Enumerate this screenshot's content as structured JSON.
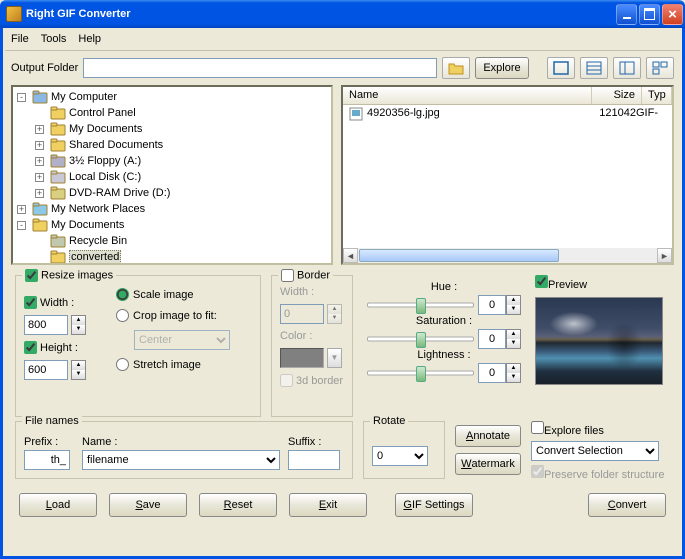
{
  "title": "Right GIF Converter",
  "menu": {
    "file": "File",
    "tools": "Tools",
    "help": "Help"
  },
  "topbar": {
    "output_label": "Output Folder",
    "output_value": "",
    "explore": "Explore"
  },
  "tree": [
    {
      "label": "My Computer",
      "icon": "computer",
      "exp": "-",
      "indent": 0
    },
    {
      "label": "Control Panel",
      "icon": "folder",
      "exp": "",
      "indent": 1
    },
    {
      "label": "My Documents",
      "icon": "folder",
      "exp": "+",
      "indent": 1
    },
    {
      "label": "Shared Documents",
      "icon": "folder",
      "exp": "+",
      "indent": 1
    },
    {
      "label": "3½ Floppy (A:)",
      "icon": "floppy",
      "exp": "+",
      "indent": 1
    },
    {
      "label": "Local Disk (C:)",
      "icon": "disk",
      "exp": "+",
      "indent": 1
    },
    {
      "label": "DVD-RAM Drive (D:)",
      "icon": "dvd",
      "exp": "+",
      "indent": 1
    },
    {
      "label": "My Network Places",
      "icon": "network",
      "exp": "+",
      "indent": 0
    },
    {
      "label": "My Documents",
      "icon": "folder",
      "exp": "-",
      "indent": 0
    },
    {
      "label": "Recycle Bin",
      "icon": "bin",
      "exp": "",
      "indent": 1
    },
    {
      "label": "converted",
      "icon": "folder",
      "exp": "",
      "indent": 1,
      "sel": true
    }
  ],
  "list": {
    "cols": {
      "name": "Name",
      "size": "Size",
      "type": "Typ"
    },
    "rows": [
      {
        "name": "4920356-lg.jpg",
        "size": "121042",
        "type": "GIF-"
      }
    ]
  },
  "resize": {
    "legend": "Resize images",
    "width_lbl": "Width :",
    "width": "800",
    "height_lbl": "Height :",
    "height": "600",
    "scale": "Scale image",
    "crop": "Crop image to fit:",
    "center": "Center",
    "stretch": "Stretch image"
  },
  "border": {
    "legend": "Border",
    "width_lbl": "Width :",
    "width": "0",
    "color_lbl": "Color :",
    "d3": "3d border"
  },
  "sliders": {
    "hue": "Hue :",
    "sat": "Saturation :",
    "light": "Lightness :",
    "val": "0"
  },
  "preview": {
    "legend": "Preview"
  },
  "filenames": {
    "legend": "File names",
    "prefix_lbl": "Prefix :",
    "prefix": "th_",
    "name_lbl": "Name :",
    "name": "filename",
    "suffix_lbl": "Suffix :",
    "suffix": ""
  },
  "rotate": {
    "legend": "Rotate",
    "val": "0"
  },
  "sidebtns": {
    "annotate": "Annotate",
    "watermark": "Watermark"
  },
  "explore": {
    "legend": "Explore files",
    "sel": "Convert Selection",
    "preserve": "Preserve folder structure"
  },
  "bottom": {
    "load": "Load",
    "save": "Save",
    "reset": "Reset",
    "exit": "Exit",
    "gif": "GIF Settings",
    "convert": "Convert"
  }
}
